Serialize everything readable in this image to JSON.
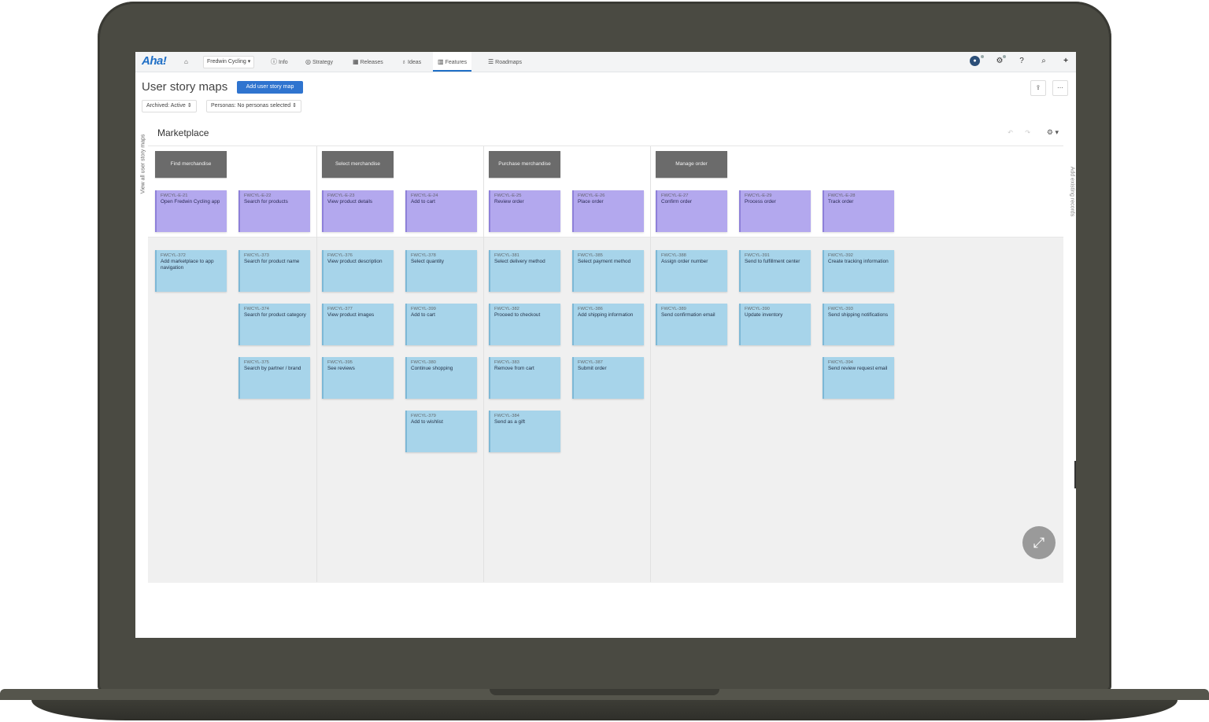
{
  "nav": {
    "logo": "Aha!",
    "workspace": "Fredwin Cycling",
    "items": [
      {
        "label": "Info",
        "icon": "info-icon"
      },
      {
        "label": "Strategy",
        "icon": "strategy-icon"
      },
      {
        "label": "Releases",
        "icon": "calendar-icon"
      },
      {
        "label": "Ideas",
        "icon": "lightbulb-icon"
      },
      {
        "label": "Features",
        "icon": "grid-icon"
      },
      {
        "label": "Roadmaps",
        "icon": "roadmap-icon"
      }
    ],
    "active": "Features"
  },
  "header": {
    "title": "User story maps",
    "add_button": "Add user story map",
    "filters": [
      "Archived: Active",
      "Personas: No personas selected"
    ]
  },
  "board": {
    "title": "Marketplace",
    "left_tab": "View all user story maps",
    "right_tab": "Add existing records",
    "activities": [
      "Find merchandise",
      "Select merchandise",
      "Purchase merchandise",
      "Manage order"
    ],
    "epics": [
      {
        "id": "FWCYL-E-21",
        "name": "Open Fredwin Cycling app"
      },
      {
        "id": "FWCYL-E-22",
        "name": "Search for products"
      },
      {
        "id": "FWCYL-E-23",
        "name": "View product details"
      },
      {
        "id": "FWCYL-E-24",
        "name": "Add to cart"
      },
      {
        "id": "FWCYL-E-25",
        "name": "Review order"
      },
      {
        "id": "FWCYL-E-26",
        "name": "Place order"
      },
      {
        "id": "FWCYL-E-27",
        "name": "Confirm order"
      },
      {
        "id": "FWCYL-E-29",
        "name": "Process order"
      },
      {
        "id": "FWCYL-E-28",
        "name": "Track order"
      }
    ],
    "stories": [
      [
        {
          "id": "FWCYL-372",
          "name": "Add marketplace to app navigation"
        }
      ],
      [
        {
          "id": "FWCYL-373",
          "name": "Search for product name"
        },
        {
          "id": "FWCYL-374",
          "name": "Search for product category"
        },
        {
          "id": "FWCYL-375",
          "name": "Search by partner / brand"
        }
      ],
      [
        {
          "id": "FWCYL-376",
          "name": "View product description"
        },
        {
          "id": "FWCYL-377",
          "name": "View product images"
        },
        {
          "id": "FWCYL-395",
          "name": "See reviews"
        }
      ],
      [
        {
          "id": "FWCYL-378",
          "name": "Select quantity"
        },
        {
          "id": "FWCYL-399",
          "name": "Add to cart"
        },
        {
          "id": "FWCYL-380",
          "name": "Continue shopping"
        },
        {
          "id": "FWCYL-379",
          "name": "Add to wishlist"
        }
      ],
      [
        {
          "id": "FWCYL-381",
          "name": "Select delivery method"
        },
        {
          "id": "FWCYL-382",
          "name": "Proceed to checkout"
        },
        {
          "id": "FWCYL-383",
          "name": "Remove from cart"
        },
        {
          "id": "FWCYL-384",
          "name": "Send as a gift"
        }
      ],
      [
        {
          "id": "FWCYL-385",
          "name": "Select payment method"
        },
        {
          "id": "FWCYL-386",
          "name": "Add shipping information"
        },
        {
          "id": "FWCYL-387",
          "name": "Submit order"
        }
      ],
      [
        {
          "id": "FWCYL-388",
          "name": "Assign order number"
        },
        {
          "id": "FWCYL-389",
          "name": "Send confirmation email"
        }
      ],
      [
        {
          "id": "FWCYL-391",
          "name": "Send to fulfillment center"
        },
        {
          "id": "FWCYL-390",
          "name": "Update inventory"
        }
      ],
      [
        {
          "id": "FWCYL-392",
          "name": "Create tracking information"
        },
        {
          "id": "FWCYL-393",
          "name": "Send shipping notifications"
        },
        {
          "id": "FWCYL-394",
          "name": "Send review request email"
        }
      ]
    ]
  },
  "colors": {
    "brand": "#1f6fc6",
    "epic": "#b3a8ee",
    "story": "#a7d4ea",
    "activity": "#6b6b6b"
  }
}
